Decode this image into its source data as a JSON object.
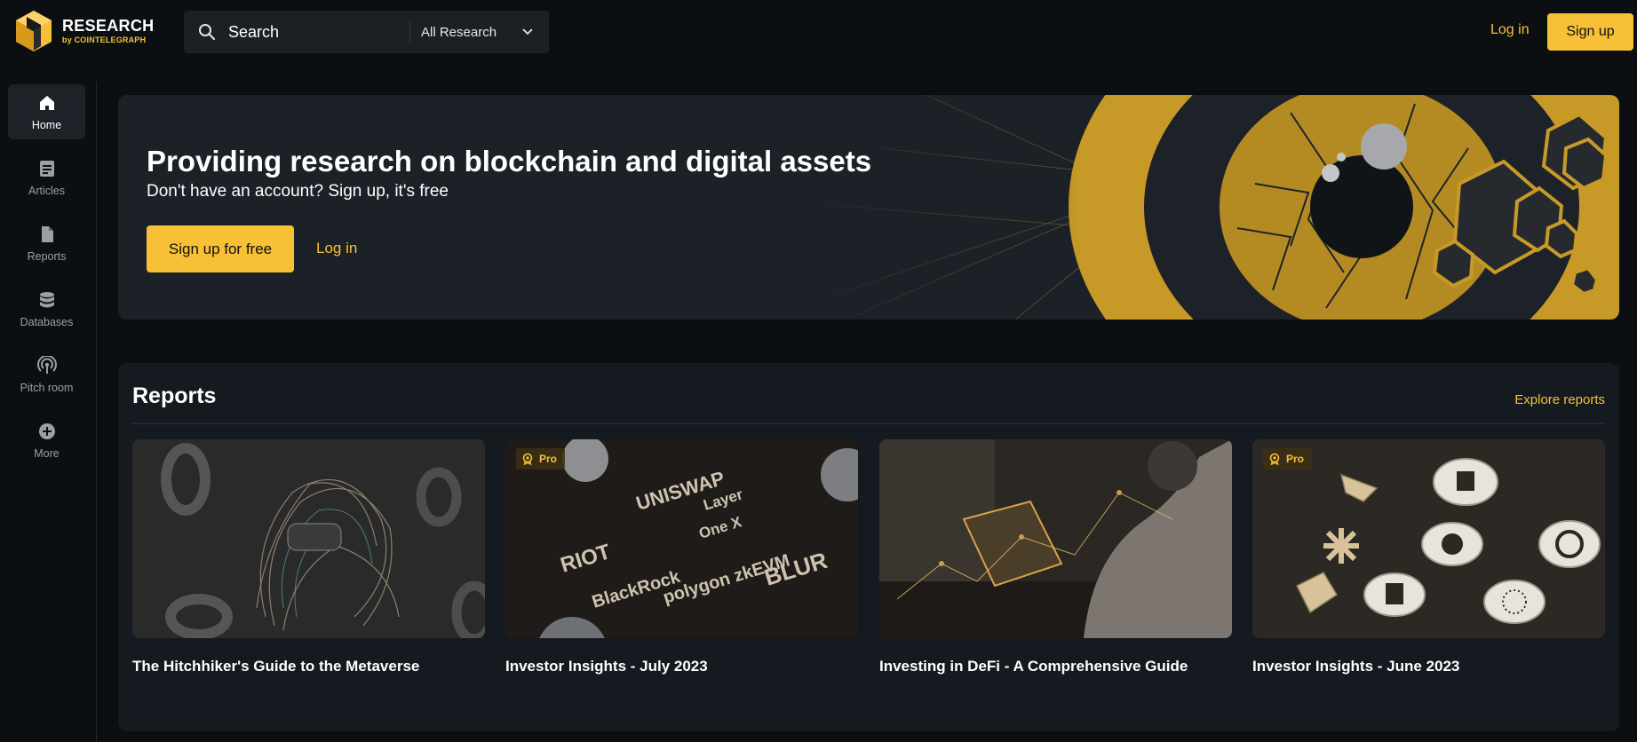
{
  "brand": {
    "title": "RESEARCH",
    "by": "by",
    "sub": "COINTELEGRAPH",
    "accent": "#f7c037"
  },
  "search": {
    "placeholder": "Search",
    "scope": "All Research"
  },
  "header": {
    "login": "Log in",
    "signup": "Sign up"
  },
  "sidebar": {
    "items": [
      {
        "label": "Home",
        "icon": "home-icon"
      },
      {
        "label": "Articles",
        "icon": "article-icon"
      },
      {
        "label": "Reports",
        "icon": "file-icon"
      },
      {
        "label": "Databases",
        "icon": "database-icon"
      },
      {
        "label": "Pitch room",
        "icon": "broadcast-icon"
      },
      {
        "label": "More",
        "icon": "plus-circle-icon"
      }
    ]
  },
  "hero": {
    "title": "Providing research on blockchain and digital assets",
    "subtitle": "Don't have an account? Sign up, it's free",
    "cta": "Sign up for free",
    "login": "Log in"
  },
  "reports": {
    "title": "Reports",
    "explore": "Explore reports",
    "badge": "Pro",
    "cards": [
      {
        "title": "The Hitchhiker's Guide to the Metaverse",
        "pro": false
      },
      {
        "title": "Investor Insights - July 2023",
        "pro": true,
        "logos": [
          "UNISWAP",
          "RIOT",
          "Layer",
          "One X",
          "BlackRock",
          "polygon zkEVM",
          "BLUR"
        ]
      },
      {
        "title": "Investing in DeFi - A Comprehensive Guide",
        "pro": false
      },
      {
        "title": "Investor Insights - June 2023",
        "pro": true
      }
    ]
  }
}
